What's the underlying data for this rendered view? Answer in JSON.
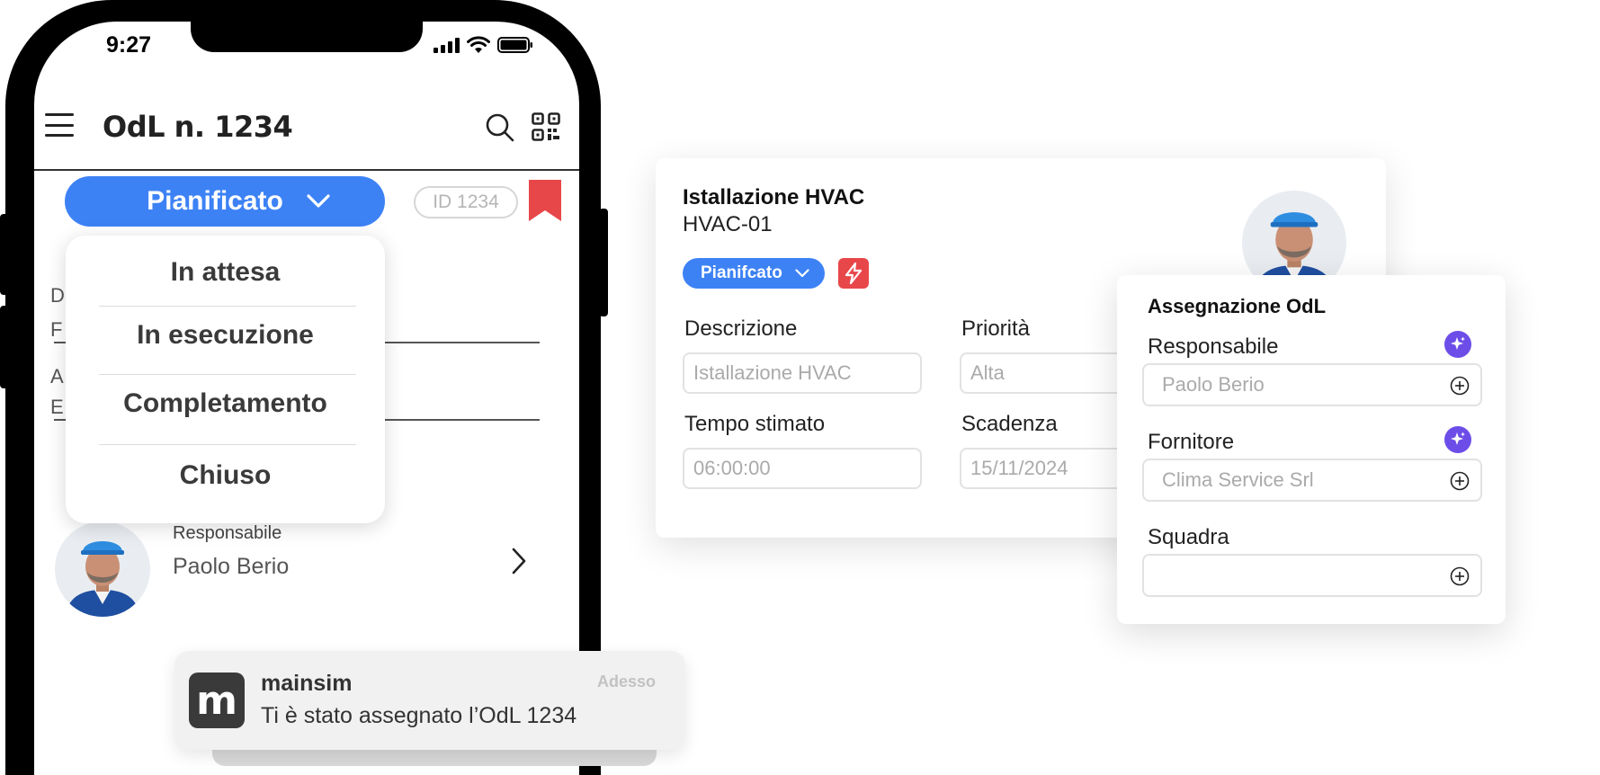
{
  "phone": {
    "status_time": "9:27",
    "title": "OdL n. 1234",
    "status_button": "Pianificato",
    "id_pill": "ID 1234",
    "dropdown_options": [
      "In attesa",
      "In esecuzione",
      "Completamento",
      "Chiuso"
    ],
    "field_peeks": [
      "D",
      "F",
      "A",
      "E"
    ],
    "responsabile_label": "Responsabile",
    "responsabile_name": "Paolo Berio"
  },
  "notification": {
    "app": "mainsim",
    "logo_letter": "m",
    "time": "Adesso",
    "message": "Ti è stato assegnato l’OdL 1234"
  },
  "work_order": {
    "title": "Istallazione HVAC",
    "code": "HVAC-01",
    "status": "Pianifcato",
    "descrizione_label": "Descrizione",
    "descrizione_value": "Istallazione HVAC",
    "priorita_label": "Priorità",
    "priorita_value": "Alta",
    "tempo_label": "Tempo stimato",
    "tempo_value": "06:00:00",
    "scadenza_label": "Scadenza",
    "scadenza_value": "15/11/2024"
  },
  "assignment": {
    "title": "Assegnazione OdL",
    "responsabile_label": "Responsabile",
    "responsabile_value": "Paolo Berio",
    "fornitore_label": "Fornitore",
    "fornitore_value": "Clima Service Srl",
    "squadra_label": "Squadra",
    "squadra_value": ""
  },
  "colors": {
    "accent_blue": "#3d82f5",
    "bookmark_red": "#e8474a",
    "ai_purple": "#6d4de8"
  },
  "icons": [
    "hamburger-icon",
    "search-icon",
    "qr-code-icon",
    "bookmark-icon",
    "chevron-down-icon",
    "chevron-right-icon",
    "lightning-icon",
    "sparkle-icon",
    "plus-circle-icon",
    "wifi-icon",
    "battery-icon",
    "signal-icon"
  ]
}
